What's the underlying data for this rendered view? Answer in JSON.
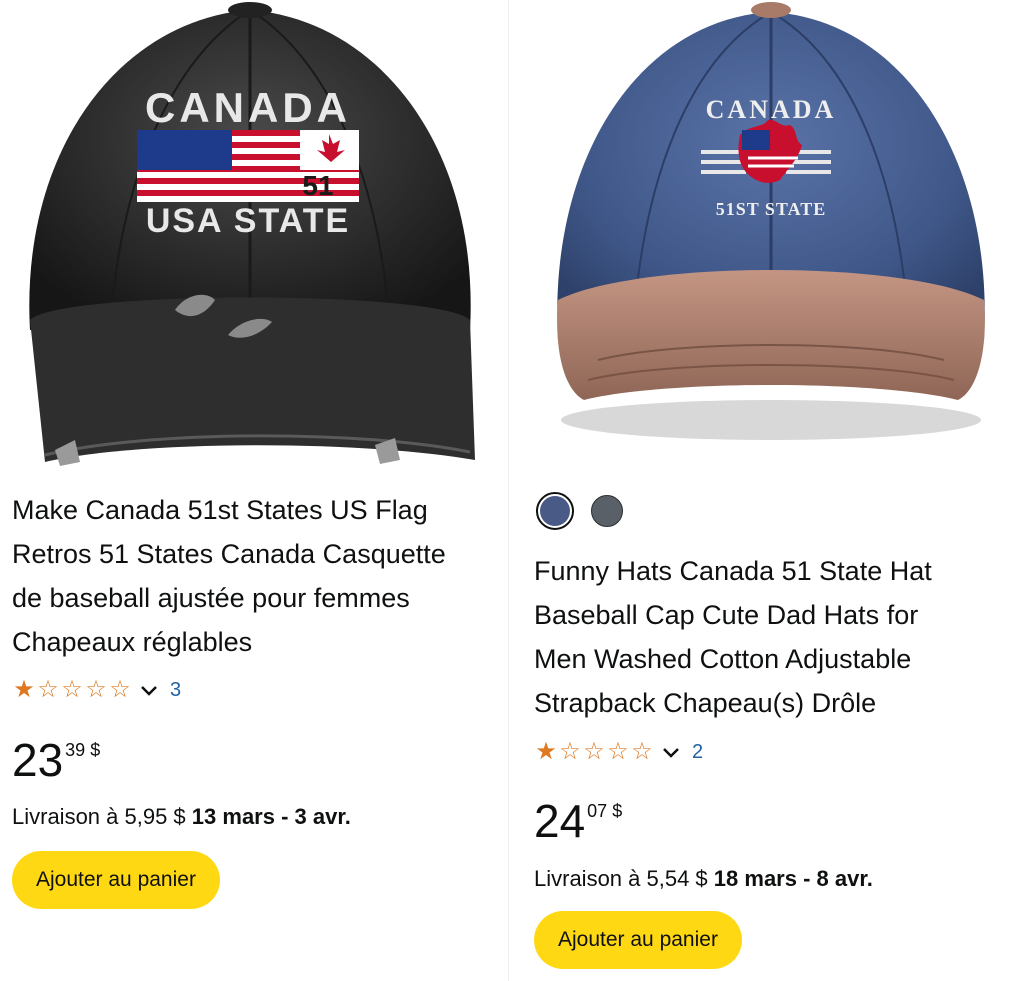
{
  "products": [
    {
      "image": {
        "alt": "black distressed cap",
        "cap_text_top": "CANADA",
        "cap_text_number": "51",
        "cap_text_bottom": "USA STATE"
      },
      "title_lines": [
        "Make Canada 51st States US Flag",
        "Retros 51 States Canada Casquette",
        "de baseball ajustée pour femmes",
        "Chapeaux réglables"
      ],
      "rating": {
        "stars": "1 of 5",
        "value": 1,
        "count": "3"
      },
      "price": {
        "whole": "23",
        "fraction": "39",
        "currency": "$"
      },
      "delivery": {
        "prefix": "Livraison à 5,95 $",
        "dates": "13 mars - 3 avr."
      },
      "cart_label": "Ajouter au panier"
    },
    {
      "image": {
        "alt": "denim blue cap with tan brim",
        "cap_text_top": "CANADA",
        "cap_text_bottom": "51ST STATE"
      },
      "swatches": [
        {
          "name": "denim-blue",
          "color": "#4a5a86",
          "selected": true
        },
        {
          "name": "charcoal",
          "color": "#5a6068",
          "selected": false
        }
      ],
      "title_lines": [
        "Funny Hats Canada 51 State Hat",
        "Baseball Cap Cute Dad Hats for",
        "Men Washed Cotton Adjustable",
        "Strapback Chapeau(s) Drôle"
      ],
      "rating": {
        "stars": "1 of 5",
        "value": 1,
        "count": "2"
      },
      "price": {
        "whole": "24",
        "fraction": "07",
        "currency": "$"
      },
      "delivery": {
        "prefix": "Livraison à 5,54 $",
        "dates": "18 mars - 8 avr."
      },
      "cart_label": "Ajouter au panier"
    }
  ],
  "colors": {
    "star": "#de7921",
    "link": "#2162a1",
    "cart_button": "#ffd814"
  },
  "icons": {
    "star_filled": "★",
    "star_empty": "☆",
    "rating_dropdown": "chevron-down-icon"
  }
}
